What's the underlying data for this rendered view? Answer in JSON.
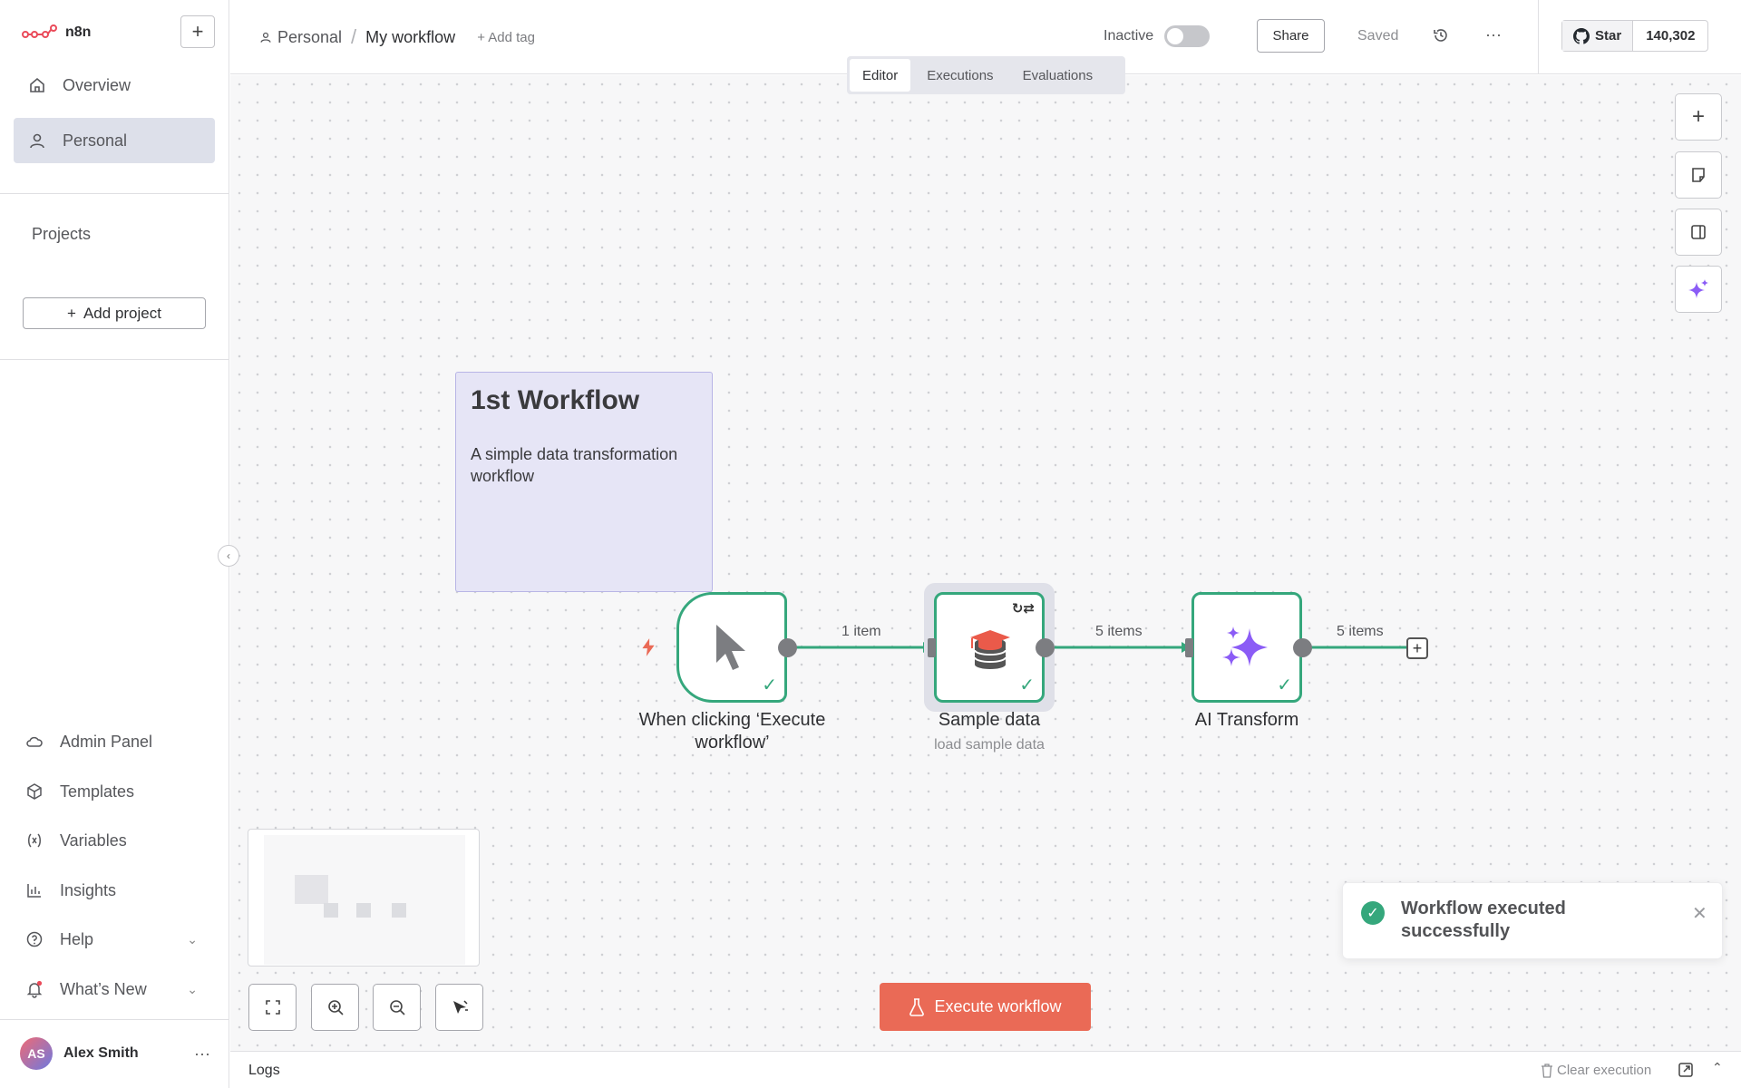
{
  "app": {
    "name": "n8n"
  },
  "sidebar": {
    "nav": [
      {
        "label": "Overview",
        "icon": "home-icon"
      },
      {
        "label": "Personal",
        "icon": "user-icon",
        "active": true
      }
    ],
    "projects_label": "Projects",
    "add_project_label": "Add project",
    "bottom": [
      {
        "label": "Admin Panel",
        "icon": "cloud-icon"
      },
      {
        "label": "Templates",
        "icon": "box-icon"
      },
      {
        "label": "Variables",
        "icon": "variable-icon"
      },
      {
        "label": "Insights",
        "icon": "chart-icon"
      },
      {
        "label": "Help",
        "icon": "help-icon"
      },
      {
        "label": "What’s New",
        "icon": "bell-icon"
      }
    ],
    "user": {
      "initials": "AS",
      "name": "Alex Smith"
    }
  },
  "header": {
    "breadcrumb_project": "Personal",
    "workflow_title": "My workflow",
    "add_tag": "+ Add tag",
    "status_label": "Inactive",
    "share_label": "Share",
    "saved_label": "Saved",
    "github_star_label": "Star",
    "github_star_count": "140,302"
  },
  "tabs": [
    {
      "label": "Editor",
      "active": true
    },
    {
      "label": "Executions"
    },
    {
      "label": "Evaluations"
    }
  ],
  "canvas": {
    "sticky": {
      "title": "1st Workflow",
      "body": "A simple data transformation workflow"
    },
    "nodes": [
      {
        "label": "When clicking ‘Execute workflow’",
        "icon": "cursor-icon"
      },
      {
        "label": "Sample data",
        "subtitle": "load sample data",
        "icon": "database-icon"
      },
      {
        "label": "AI Transform",
        "icon": "sparkles-icon"
      }
    ],
    "edges": [
      {
        "label": "1 item"
      },
      {
        "label": "5 items"
      },
      {
        "label": "5 items"
      }
    ],
    "execute_button_label": "Execute workflow"
  },
  "toast": {
    "message": "Workflow executed successfully"
  },
  "logs": {
    "label": "Logs",
    "clear_label": "Clear execution"
  },
  "colors": {
    "accent": "#ea6a56",
    "success": "#35a77c",
    "sticky_bg": "#e6e5f6",
    "ai_purple": "#8b5cf6"
  }
}
